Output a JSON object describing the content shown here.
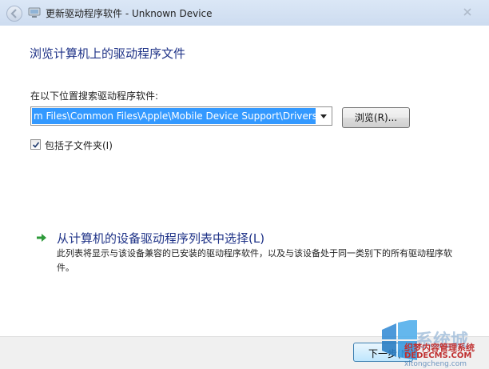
{
  "window": {
    "title": "更新驱动程序软件 - Unknown Device"
  },
  "page": {
    "heading": "浏览计算机上的驱动程序文件",
    "search_label": "在以下位置搜索驱动程序软件:",
    "path_value": "m Files\\Common Files\\Apple\\Mobile Device Support\\Drivers",
    "browse_label": "浏览(R)...",
    "include_subfolders_label": "包括子文件夹(I)",
    "include_subfolders_checked": true,
    "pick_link": "从计算机的设备驱动程序列表中选择(L)",
    "pick_description": "此列表将显示与该设备兼容的已安装的驱动程序软件，以及与该设备处于同一类别下的所有驱动程序软件。"
  },
  "footer": {
    "next_label": "下一步(N)"
  },
  "watermark": {
    "brand_cn": "系统城",
    "site_cn": "织梦内容管理系统",
    "site_en": "DEDECMS.COM",
    "url": "xitongcheng.com"
  },
  "icons": {
    "back": "back-arrow-icon",
    "device": "device-icon",
    "dropdown": "chevron-down-icon",
    "check": "checkmark-icon",
    "link_arrow": "green-arrow-icon"
  }
}
